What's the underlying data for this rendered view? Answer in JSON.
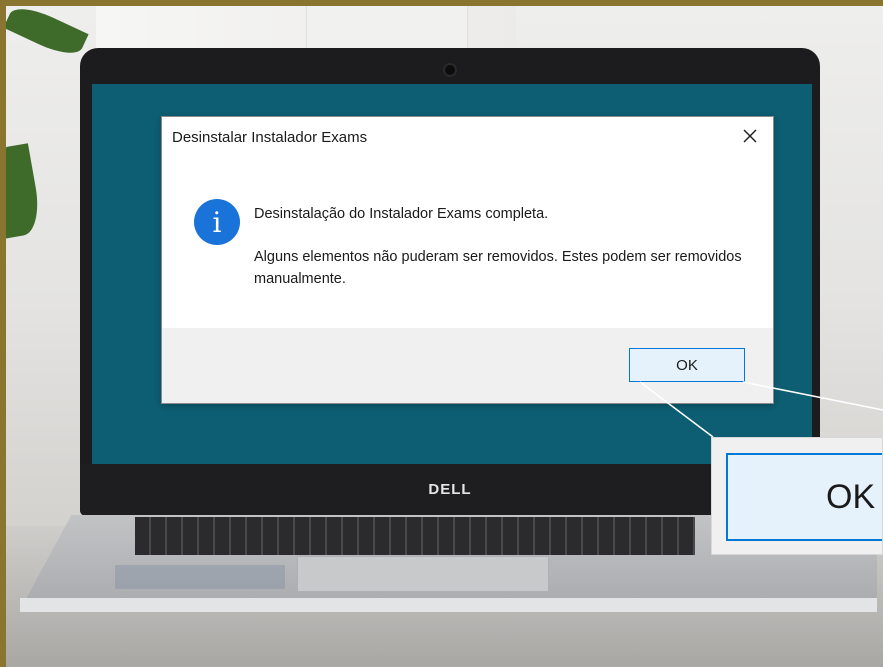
{
  "dialog": {
    "title": "Desinstalar Instalador Exams",
    "close_symbol": "✕",
    "icon": "info-icon",
    "icon_glyph": "i",
    "message_line1": "Desinstalação do Instalador Exams completa.",
    "message_line2": "Alguns elementos não puderam ser removidos. Estes podem ser removidos manualmente.",
    "ok_label": "OK"
  },
  "laptop": {
    "brand": "DELL"
  },
  "zoom_callout": {
    "label": "OK"
  },
  "colors": {
    "screen_background": "#0d5e73",
    "accent_blue": "#0078d7",
    "frame_border": "#8a7530"
  }
}
